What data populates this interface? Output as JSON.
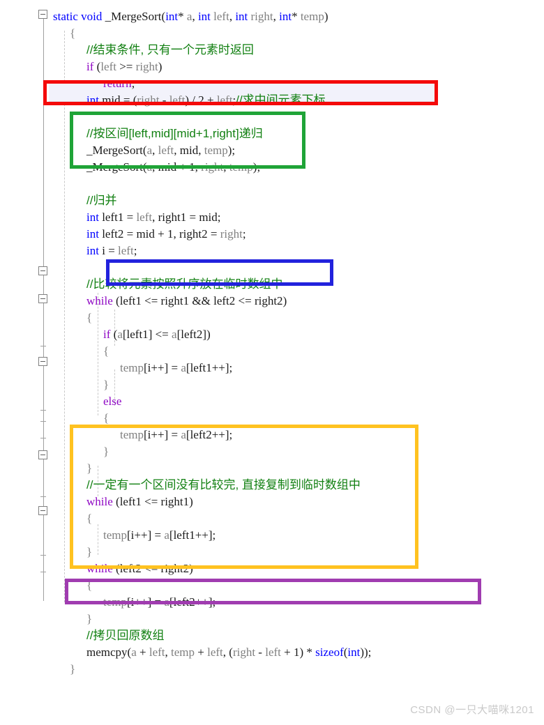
{
  "editor": {
    "language": "C",
    "function_name": "_MergeSort",
    "font_size_px": 17,
    "line_height_px": 24,
    "background": "#ffffff",
    "current_line_highlight": "#f2f2fb"
  },
  "syntax_colors": {
    "keyword_type": "#0000ff",
    "keyword_control": "#8f08c4",
    "comment": "#128012",
    "parameter": "#808080",
    "local_variable": "#1a1a1a",
    "punctuation": "#1a1a1a"
  },
  "annotation_boxes": [
    {
      "id": "box-mid",
      "color": "#f40a0a",
      "label": "red-box-mid-calculation"
    },
    {
      "id": "box-recursion",
      "color": "#1fa437",
      "label": "green-box-recursive-calls"
    },
    {
      "id": "box-while-cond",
      "color": "#2222dd",
      "label": "blue-box-merge-while-condition"
    },
    {
      "id": "box-tail-copy",
      "color": "#ffc220",
      "label": "orange-box-remaining-copy"
    },
    {
      "id": "box-memcpy",
      "color": "#a03cb0",
      "label": "purple-box-memcpy-back"
    }
  ],
  "fold_markers": [
    {
      "name": "fold-toggle-function",
      "state": "expanded",
      "symbol": "-"
    },
    {
      "name": "fold-toggle-while-merge",
      "state": "expanded",
      "symbol": "-"
    },
    {
      "name": "fold-toggle-if",
      "state": "expanded",
      "symbol": "-"
    },
    {
      "name": "fold-toggle-else",
      "state": "expanded",
      "symbol": "-"
    },
    {
      "name": "fold-toggle-while-left1",
      "state": "expanded",
      "symbol": "-"
    },
    {
      "name": "fold-toggle-while-left2",
      "state": "expanded",
      "symbol": "-"
    }
  ],
  "code_lines": [
    {
      "n": 1,
      "indent": 0,
      "tokens": [
        {
          "t": "static",
          "c": "kw"
        },
        {
          "t": " ",
          "c": "punc"
        },
        {
          "t": "void",
          "c": "kw"
        },
        {
          "t": " ",
          "c": "punc"
        },
        {
          "t": "_MergeSort",
          "c": "fn"
        },
        {
          "t": "(",
          "c": "punc"
        },
        {
          "t": "int",
          "c": "kw"
        },
        {
          "t": "*",
          "c": "punc"
        },
        {
          "t": " ",
          "c": "punc"
        },
        {
          "t": "a",
          "c": "par"
        },
        {
          "t": ", ",
          "c": "punc"
        },
        {
          "t": "int",
          "c": "kw"
        },
        {
          "t": " ",
          "c": "punc"
        },
        {
          "t": "left",
          "c": "par"
        },
        {
          "t": ", ",
          "c": "punc"
        },
        {
          "t": "int",
          "c": "kw"
        },
        {
          "t": " ",
          "c": "punc"
        },
        {
          "t": "right",
          "c": "par"
        },
        {
          "t": ", ",
          "c": "punc"
        },
        {
          "t": "int",
          "c": "kw"
        },
        {
          "t": "*",
          "c": "punc"
        },
        {
          "t": " ",
          "c": "punc"
        },
        {
          "t": "temp",
          "c": "par"
        },
        {
          "t": ")",
          "c": "punc"
        }
      ]
    },
    {
      "n": 2,
      "indent": 1,
      "tokens": [
        {
          "t": "{",
          "c": "brace"
        }
      ]
    },
    {
      "n": 3,
      "indent": 2,
      "tokens": [
        {
          "t": "//结束条件, 只有一个元素时返回",
          "c": "cmt"
        }
      ]
    },
    {
      "n": 4,
      "indent": 2,
      "tokens": [
        {
          "t": "if",
          "c": "ctl"
        },
        {
          "t": " (",
          "c": "punc"
        },
        {
          "t": "left",
          "c": "par"
        },
        {
          "t": " >= ",
          "c": "punc"
        },
        {
          "t": "right",
          "c": "par"
        },
        {
          "t": ")",
          "c": "punc"
        }
      ]
    },
    {
      "n": 5,
      "indent": 3,
      "tokens": [
        {
          "t": "return",
          "c": "ctl"
        },
        {
          "t": ";",
          "c": "punc"
        }
      ]
    },
    {
      "n": 6,
      "indent": 2,
      "tokens": [
        {
          "t": "int",
          "c": "kw"
        },
        {
          "t": " ",
          "c": "punc"
        },
        {
          "t": "mid",
          "c": "var"
        },
        {
          "t": " = (",
          "c": "punc"
        },
        {
          "t": "right",
          "c": "par"
        },
        {
          "t": " - ",
          "c": "punc"
        },
        {
          "t": "left",
          "c": "par"
        },
        {
          "t": ") / ",
          "c": "punc"
        },
        {
          "t": "2",
          "c": "num"
        },
        {
          "t": " + ",
          "c": "punc"
        },
        {
          "t": "left",
          "c": "par"
        },
        {
          "t": ";",
          "c": "punc"
        },
        {
          "t": "//求中间元素下标",
          "c": "cmt"
        }
      ]
    },
    {
      "n": 7,
      "indent": 2,
      "tokens": []
    },
    {
      "n": 8,
      "indent": 2,
      "tokens": [
        {
          "t": "//按区间[left,mid][mid+1,right]递归",
          "c": "cmt"
        }
      ]
    },
    {
      "n": 9,
      "indent": 2,
      "tokens": [
        {
          "t": "_MergeSort",
          "c": "fn"
        },
        {
          "t": "(",
          "c": "punc"
        },
        {
          "t": "a",
          "c": "par"
        },
        {
          "t": ", ",
          "c": "punc"
        },
        {
          "t": "left",
          "c": "par"
        },
        {
          "t": ", ",
          "c": "punc"
        },
        {
          "t": "mid",
          "c": "var"
        },
        {
          "t": ", ",
          "c": "punc"
        },
        {
          "t": "temp",
          "c": "par"
        },
        {
          "t": ");",
          "c": "punc"
        }
      ]
    },
    {
      "n": 10,
      "indent": 2,
      "tokens": [
        {
          "t": "_MergeSort",
          "c": "fn"
        },
        {
          "t": "(",
          "c": "punc"
        },
        {
          "t": "a",
          "c": "par"
        },
        {
          "t": ", ",
          "c": "punc"
        },
        {
          "t": "mid",
          "c": "var"
        },
        {
          "t": " + ",
          "c": "punc"
        },
        {
          "t": "1",
          "c": "num"
        },
        {
          "t": ", ",
          "c": "punc"
        },
        {
          "t": "right",
          "c": "par"
        },
        {
          "t": ", ",
          "c": "punc"
        },
        {
          "t": "temp",
          "c": "par"
        },
        {
          "t": ");",
          "c": "punc"
        }
      ]
    },
    {
      "n": 11,
      "indent": 2,
      "tokens": []
    },
    {
      "n": 12,
      "indent": 2,
      "tokens": [
        {
          "t": "//归并",
          "c": "cmt"
        }
      ]
    },
    {
      "n": 13,
      "indent": 2,
      "tokens": [
        {
          "t": "int",
          "c": "kw"
        },
        {
          "t": " ",
          "c": "punc"
        },
        {
          "t": "left1",
          "c": "var"
        },
        {
          "t": " = ",
          "c": "punc"
        },
        {
          "t": "left",
          "c": "par"
        },
        {
          "t": ", ",
          "c": "punc"
        },
        {
          "t": "right1",
          "c": "var"
        },
        {
          "t": " = ",
          "c": "punc"
        },
        {
          "t": "mid",
          "c": "var"
        },
        {
          "t": ";",
          "c": "punc"
        }
      ]
    },
    {
      "n": 14,
      "indent": 2,
      "tokens": [
        {
          "t": "int",
          "c": "kw"
        },
        {
          "t": " ",
          "c": "punc"
        },
        {
          "t": "left2",
          "c": "var"
        },
        {
          "t": " = ",
          "c": "punc"
        },
        {
          "t": "mid",
          "c": "var"
        },
        {
          "t": " + ",
          "c": "punc"
        },
        {
          "t": "1",
          "c": "num"
        },
        {
          "t": ", ",
          "c": "punc"
        },
        {
          "t": "right2",
          "c": "var"
        },
        {
          "t": " = ",
          "c": "punc"
        },
        {
          "t": "right",
          "c": "par"
        },
        {
          "t": ";",
          "c": "punc"
        }
      ]
    },
    {
      "n": 15,
      "indent": 2,
      "tokens": [
        {
          "t": "int",
          "c": "kw"
        },
        {
          "t": " ",
          "c": "punc"
        },
        {
          "t": "i",
          "c": "var"
        },
        {
          "t": " = ",
          "c": "punc"
        },
        {
          "t": "left",
          "c": "par"
        },
        {
          "t": ";",
          "c": "punc"
        }
      ]
    },
    {
      "n": 16,
      "indent": 2,
      "tokens": []
    },
    {
      "n": 17,
      "indent": 2,
      "tokens": [
        {
          "t": "//比较将元素按照升序放在临时数组中",
          "c": "cmt"
        }
      ]
    },
    {
      "n": 18,
      "indent": 2,
      "tokens": [
        {
          "t": "while",
          "c": "ctl"
        },
        {
          "t": " (",
          "c": "punc"
        },
        {
          "t": "left1",
          "c": "var"
        },
        {
          "t": " <= ",
          "c": "punc"
        },
        {
          "t": "right1",
          "c": "var"
        },
        {
          "t": " && ",
          "c": "punc"
        },
        {
          "t": "left2",
          "c": "var"
        },
        {
          "t": " <= ",
          "c": "punc"
        },
        {
          "t": "right2",
          "c": "var"
        },
        {
          "t": ")",
          "c": "punc"
        }
      ]
    },
    {
      "n": 19,
      "indent": 2,
      "tokens": [
        {
          "t": "{",
          "c": "brace"
        }
      ]
    },
    {
      "n": 20,
      "indent": 3,
      "tokens": [
        {
          "t": "if",
          "c": "ctl"
        },
        {
          "t": " (",
          "c": "punc"
        },
        {
          "t": "a",
          "c": "par"
        },
        {
          "t": "[",
          "c": "punc"
        },
        {
          "t": "left1",
          "c": "var"
        },
        {
          "t": "] <= ",
          "c": "punc"
        },
        {
          "t": "a",
          "c": "par"
        },
        {
          "t": "[",
          "c": "punc"
        },
        {
          "t": "left2",
          "c": "var"
        },
        {
          "t": "])",
          "c": "punc"
        }
      ]
    },
    {
      "n": 21,
      "indent": 3,
      "tokens": [
        {
          "t": "{",
          "c": "brace"
        }
      ]
    },
    {
      "n": 22,
      "indent": 4,
      "tokens": [
        {
          "t": "temp",
          "c": "par"
        },
        {
          "t": "[",
          "c": "punc"
        },
        {
          "t": "i",
          "c": "var"
        },
        {
          "t": "++] = ",
          "c": "punc"
        },
        {
          "t": "a",
          "c": "par"
        },
        {
          "t": "[",
          "c": "punc"
        },
        {
          "t": "left1",
          "c": "var"
        },
        {
          "t": "++];",
          "c": "punc"
        }
      ]
    },
    {
      "n": 23,
      "indent": 3,
      "tokens": [
        {
          "t": "}",
          "c": "brace"
        }
      ]
    },
    {
      "n": 24,
      "indent": 3,
      "tokens": [
        {
          "t": "else",
          "c": "ctl"
        }
      ]
    },
    {
      "n": 25,
      "indent": 3,
      "tokens": [
        {
          "t": "{",
          "c": "brace"
        }
      ]
    },
    {
      "n": 26,
      "indent": 4,
      "tokens": [
        {
          "t": "temp",
          "c": "par"
        },
        {
          "t": "[",
          "c": "punc"
        },
        {
          "t": "i",
          "c": "var"
        },
        {
          "t": "++] = ",
          "c": "punc"
        },
        {
          "t": "a",
          "c": "par"
        },
        {
          "t": "[",
          "c": "punc"
        },
        {
          "t": "left2",
          "c": "var"
        },
        {
          "t": "++];",
          "c": "punc"
        }
      ]
    },
    {
      "n": 27,
      "indent": 3,
      "tokens": [
        {
          "t": "}",
          "c": "brace"
        }
      ]
    },
    {
      "n": 28,
      "indent": 2,
      "tokens": [
        {
          "t": "}",
          "c": "brace"
        }
      ]
    },
    {
      "n": 29,
      "indent": 2,
      "tokens": [
        {
          "t": "//一定有一个区间没有比较完, 直接复制到临时数组中",
          "c": "cmt"
        }
      ]
    },
    {
      "n": 30,
      "indent": 2,
      "tokens": [
        {
          "t": "while",
          "c": "ctl"
        },
        {
          "t": " (",
          "c": "punc"
        },
        {
          "t": "left1",
          "c": "var"
        },
        {
          "t": " <= ",
          "c": "punc"
        },
        {
          "t": "right1",
          "c": "var"
        },
        {
          "t": ")",
          "c": "punc"
        }
      ]
    },
    {
      "n": 31,
      "indent": 2,
      "tokens": [
        {
          "t": "{",
          "c": "brace"
        }
      ]
    },
    {
      "n": 32,
      "indent": 3,
      "tokens": [
        {
          "t": "temp",
          "c": "par"
        },
        {
          "t": "[",
          "c": "punc"
        },
        {
          "t": "i",
          "c": "var"
        },
        {
          "t": "++] = ",
          "c": "punc"
        },
        {
          "t": "a",
          "c": "par"
        },
        {
          "t": "[",
          "c": "punc"
        },
        {
          "t": "left1",
          "c": "var"
        },
        {
          "t": "++];",
          "c": "punc"
        }
      ]
    },
    {
      "n": 33,
      "indent": 2,
      "tokens": [
        {
          "t": "}",
          "c": "brace"
        }
      ]
    },
    {
      "n": 34,
      "indent": 2,
      "tokens": [
        {
          "t": "while",
          "c": "ctl"
        },
        {
          "t": " (",
          "c": "punc"
        },
        {
          "t": "left2",
          "c": "var"
        },
        {
          "t": " <= ",
          "c": "punc"
        },
        {
          "t": "right2",
          "c": "var"
        },
        {
          "t": ")",
          "c": "punc"
        }
      ]
    },
    {
      "n": 35,
      "indent": 2,
      "tokens": [
        {
          "t": "{",
          "c": "brace"
        }
      ]
    },
    {
      "n": 36,
      "indent": 3,
      "tokens": [
        {
          "t": "temp",
          "c": "par"
        },
        {
          "t": "[",
          "c": "punc"
        },
        {
          "t": "i",
          "c": "var"
        },
        {
          "t": "++] = ",
          "c": "punc"
        },
        {
          "t": "a",
          "c": "par"
        },
        {
          "t": "[",
          "c": "punc"
        },
        {
          "t": "left2",
          "c": "var"
        },
        {
          "t": "++];",
          "c": "punc"
        }
      ]
    },
    {
      "n": 37,
      "indent": 2,
      "tokens": [
        {
          "t": "}",
          "c": "brace"
        }
      ]
    },
    {
      "n": 38,
      "indent": 2,
      "tokens": [
        {
          "t": "//拷贝回原数组",
          "c": "cmt"
        }
      ]
    },
    {
      "n": 39,
      "indent": 2,
      "tokens": [
        {
          "t": "memcpy",
          "c": "fn"
        },
        {
          "t": "(",
          "c": "punc"
        },
        {
          "t": "a",
          "c": "par"
        },
        {
          "t": " + ",
          "c": "punc"
        },
        {
          "t": "left",
          "c": "par"
        },
        {
          "t": ", ",
          "c": "punc"
        },
        {
          "t": "temp",
          "c": "par"
        },
        {
          "t": " + ",
          "c": "punc"
        },
        {
          "t": "left",
          "c": "par"
        },
        {
          "t": ", (",
          "c": "punc"
        },
        {
          "t": "right",
          "c": "par"
        },
        {
          "t": " - ",
          "c": "punc"
        },
        {
          "t": "left",
          "c": "par"
        },
        {
          "t": " + ",
          "c": "punc"
        },
        {
          "t": "1",
          "c": "num"
        },
        {
          "t": ") * ",
          "c": "punc"
        },
        {
          "t": "sizeof",
          "c": "kw"
        },
        {
          "t": "(",
          "c": "punc"
        },
        {
          "t": "int",
          "c": "kw"
        },
        {
          "t": "));",
          "c": "punc"
        }
      ]
    },
    {
      "n": 40,
      "indent": 1,
      "tokens": [
        {
          "t": "}",
          "c": "brace"
        }
      ]
    }
  ],
  "watermark": {
    "text": "CSDN @一只大喵咪1201"
  }
}
